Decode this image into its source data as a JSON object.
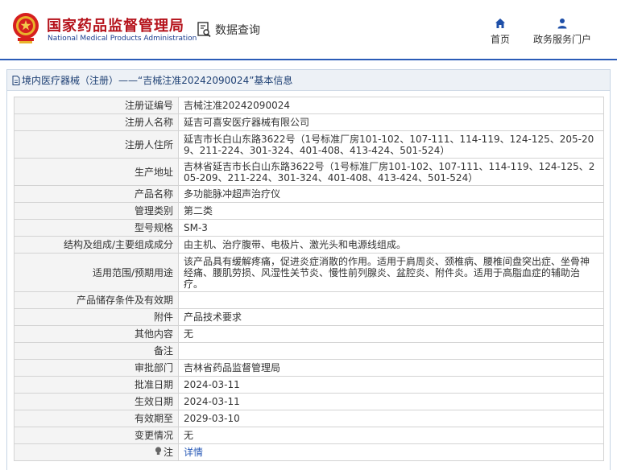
{
  "header": {
    "brand_cn": "国家药品监督管理局",
    "brand_en": "National Medical Products Administration",
    "query_label": "数据查询",
    "nav": [
      {
        "label": "首页",
        "icon": "home-icon"
      },
      {
        "label": "政务服务门户",
        "icon": "user-icon"
      }
    ]
  },
  "panel": {
    "title": "境内医疗器械（注册）——“吉械注准20242090024”基本信息"
  },
  "rows": [
    {
      "label": "注册证编号",
      "value": "吉械注准20242090024"
    },
    {
      "label": "注册人名称",
      "value": "延吉可喜安医疗器械有限公司"
    },
    {
      "label": "注册人住所",
      "value": "延吉市长白山东路3622号（1号标准厂房101-102、107-111、114-119、124-125、205-209、211-224、301-324、401-408、413-424、501-524）"
    },
    {
      "label": "生产地址",
      "value": "吉林省延吉市长白山东路3622号（1号标准厂房101-102、107-111、114-119、124-125、205-209、211-224、301-324、401-408、413-424、501-524）"
    },
    {
      "label": "产品名称",
      "value": "多功能脉冲超声治疗仪"
    },
    {
      "label": "管理类别",
      "value": "第二类"
    },
    {
      "label": "型号规格",
      "value": "SM-3"
    },
    {
      "label": "结构及组成/主要组成成分",
      "value": "由主机、治疗腹带、电极片、激光头和电源线组成。"
    },
    {
      "label": "适用范围/预期用途",
      "value": "该产品具有缓解疼痛，促进炎症消散的作用。适用于肩周炎、颈椎病、腰椎间盘突出症、坐骨神经痛、腰肌劳损、风湿性关节炎、慢性前列腺炎、盆腔炎、附件炎。适用于高脂血症的辅助治疗。"
    },
    {
      "label": "产品储存条件及有效期",
      "value": ""
    },
    {
      "label": "附件",
      "value": "产品技术要求"
    },
    {
      "label": "其他内容",
      "value": "无"
    },
    {
      "label": "备注",
      "value": ""
    },
    {
      "label": "审批部门",
      "value": "吉林省药品监督管理局"
    },
    {
      "label": "批准日期",
      "value": "2024-03-11"
    },
    {
      "label": "生效日期",
      "value": "2024-03-11"
    },
    {
      "label": "有效期至",
      "value": "2029-03-10"
    },
    {
      "label": "变更情况",
      "value": "无"
    }
  ],
  "note_row": {
    "label": "注",
    "link": "详情",
    "icon": "lightbulb-icon"
  }
}
